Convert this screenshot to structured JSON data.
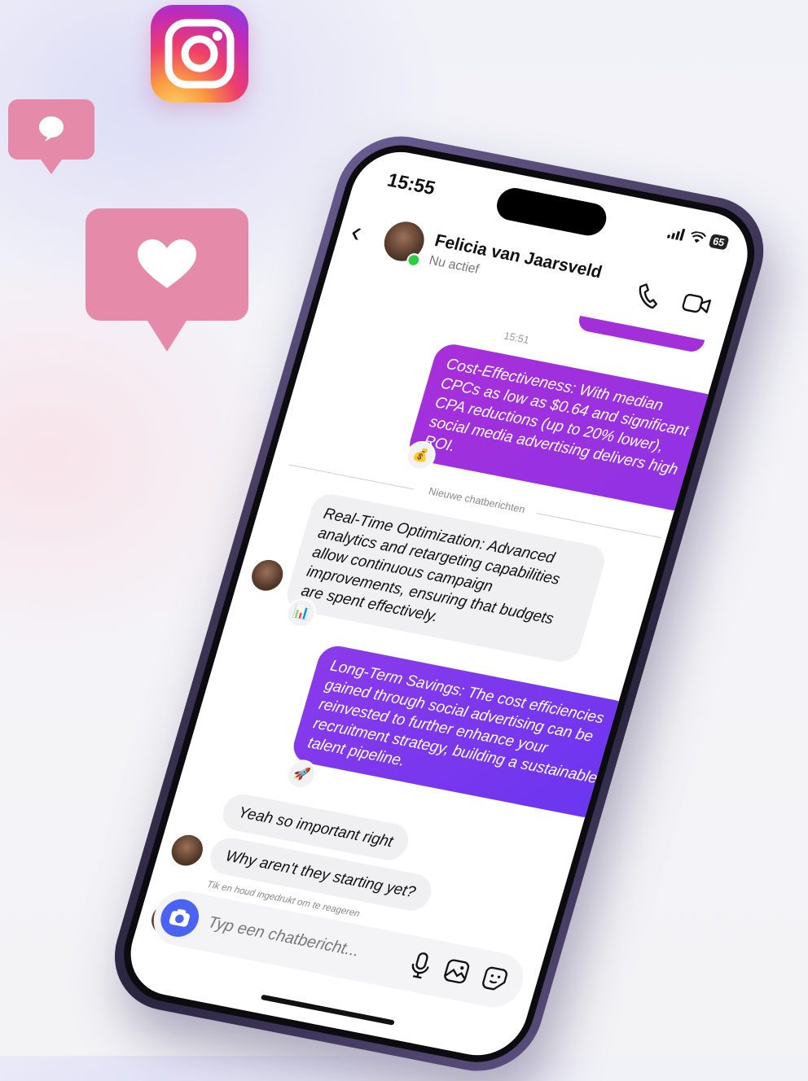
{
  "status_bar": {
    "time": "15:55",
    "battery": "65"
  },
  "chat_header": {
    "contact_name": "Felicia van Jaarsveld",
    "contact_status": "Nu actief"
  },
  "thread": {
    "timestamp": "15:51",
    "messages": [
      {
        "sender": "me",
        "text": "Cost-Effectiveness: With median CPCs as low as $0.64 and significant CPA reductions (up to 20% lower), social media advertising delivers high ROI.",
        "reaction": "💰"
      },
      {
        "sender": "contact",
        "text": "Real-Time Optimization: Advanced analytics and retargeting capabilities allow continuous campaign improvements, ensuring that budgets are spent effectively.",
        "reaction": "📊"
      },
      {
        "sender": "me",
        "text": "Long-Term Savings: The cost efficiencies gained through social advertising can be reinvested to further enhance your recruitment strategy, building a sustainable talent pipeline.",
        "reaction": "🚀"
      },
      {
        "sender": "contact",
        "text": "Yeah so important right"
      },
      {
        "sender": "contact",
        "text": "Why aren't they starting yet?"
      }
    ],
    "new_messages_divider": "Nieuwe chatberichten",
    "hint": "Tik en houd ingedrukt om te reageren",
    "typing_indicator": "•••"
  },
  "composer": {
    "placeholder": "Typ een chatbericht..."
  },
  "colors": {
    "outgoing_start": "#a52fd9",
    "outgoing_end": "#6a35f0",
    "camera_button": "#4b63f2",
    "online": "#2ecc40"
  }
}
